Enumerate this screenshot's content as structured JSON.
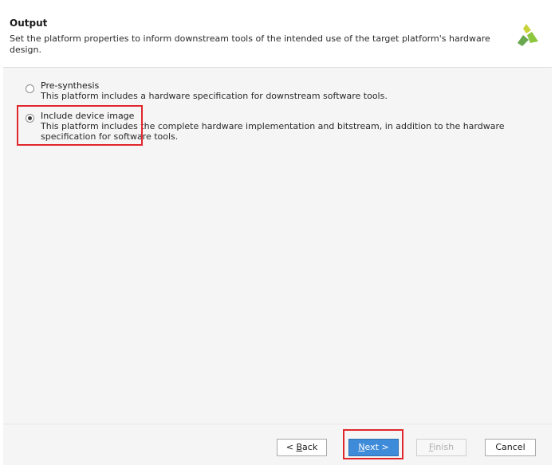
{
  "header": {
    "title": "Output",
    "description": "Set the platform properties to inform downstream tools of the intended use of the target platform's hardware design.",
    "logo_icon": "xilinx-logo-icon"
  },
  "options": [
    {
      "label": "Pre-synthesis",
      "description": "This platform includes a hardware specification for downstream software tools.",
      "selected": false
    },
    {
      "label": "Include device image",
      "description": "This platform includes the complete hardware implementation and bitstream, in addition to the hardware specification for software tools.",
      "selected": true
    }
  ],
  "footer": {
    "back": {
      "prefix": "< ",
      "mnemonic": "B",
      "rest": "ack"
    },
    "next": {
      "prefix": "",
      "mnemonic": "N",
      "rest": "ext >"
    },
    "finish": {
      "prefix": "",
      "mnemonic": "F",
      "rest": "inish"
    },
    "cancel": {
      "label": "Cancel"
    }
  },
  "colors": {
    "highlight": "#e0272c",
    "primary_button": "#3d8bd9",
    "logo_green": "#6aa84f",
    "logo_yellow": "#c9d43a"
  }
}
